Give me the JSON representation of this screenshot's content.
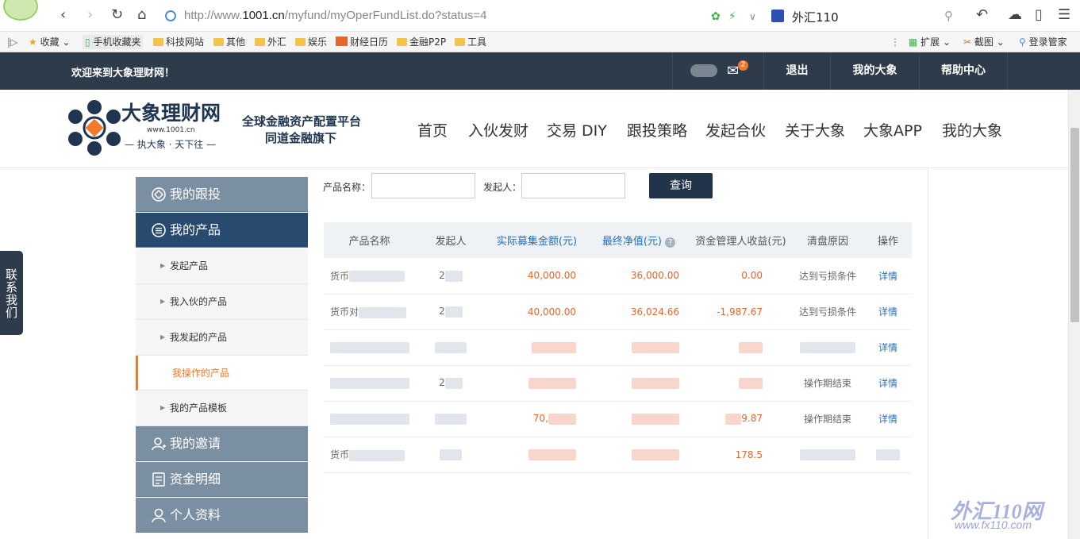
{
  "browser": {
    "url_prefix": "http://www.",
    "url_domain": "1001.cn",
    "url_path": "/myfund/myOperFundList.do?status=4",
    "search_site": "外汇110",
    "bookmarks": [
      "收藏",
      "手机收藏夹",
      "科技网站",
      "其他",
      "外汇",
      "娱乐",
      "财经日历",
      "金融P2P",
      "工具"
    ],
    "right_tools": [
      "扩展",
      "截图",
      "登录管家"
    ]
  },
  "topbar": {
    "welcome": "欢迎来到大象理财网！",
    "mail_count": "2",
    "logout": "退出",
    "my_daxiang": "我的大象",
    "help": "帮助中心"
  },
  "header": {
    "logo_title": "大象理财网",
    "logo_url": "www.1001.cn",
    "logo_slogan": "— 执大象 · 天下往 —",
    "tagline_1": "全球金融资产配置平台",
    "tagline_2": "同道金融旗下",
    "nav": [
      "首页",
      "入伙发财",
      "交易 DIY",
      "跟投策略",
      "发起合伙",
      "关于大象",
      "大象APP",
      "我的大象"
    ]
  },
  "sidebar": {
    "follow": "我的跟投",
    "products": "我的产品",
    "sub": [
      "发起产品",
      "我入伙的产品",
      "我发起的产品",
      "我操作的产品",
      "我的产品模板"
    ],
    "invite": "我的邀请",
    "funds": "资金明细",
    "profile": "个人资料"
  },
  "filters": {
    "product_name_label": "产品名称：",
    "initiator_label": "发起人：",
    "query": "查询"
  },
  "table": {
    "headers": [
      "产品名称",
      "发起人",
      "实际募集金额(元)",
      "最终净值(元)",
      "资金管理人收益(元)",
      "清盘原因",
      "操作"
    ],
    "rows": [
      {
        "name": "货币",
        "initiator": "2",
        "raised": "40,000.00",
        "nav": "36,000.00",
        "profit": "0.00",
        "reason": "达到亏损条件",
        "op": "详情"
      },
      {
        "name": "货币对",
        "initiator": "2",
        "raised": "40,000.00",
        "nav": "36,024.66",
        "profit": "-1,987.67",
        "reason": "达到亏损条件",
        "op": "详情"
      },
      {
        "name": "",
        "initiator": "",
        "raised": "",
        "nav": "",
        "profit": "",
        "reason": "",
        "op": "详情"
      },
      {
        "name": "",
        "initiator": "2",
        "raised": "",
        "nav": "",
        "profit": "",
        "reason": "操作期结束",
        "op": "详情"
      },
      {
        "name": "",
        "initiator": "",
        "raised": "70,",
        "nav": "",
        "profit": "9.87",
        "reason": "操作期结束",
        "op": "详情"
      },
      {
        "name": "货币",
        "initiator": "",
        "raised": "",
        "nav": "",
        "profit": "178.5",
        "reason": "",
        "op": ""
      }
    ]
  },
  "contact_tab": "联系我们",
  "watermark": "外汇110网",
  "watermark_url": "www.fx110.com"
}
